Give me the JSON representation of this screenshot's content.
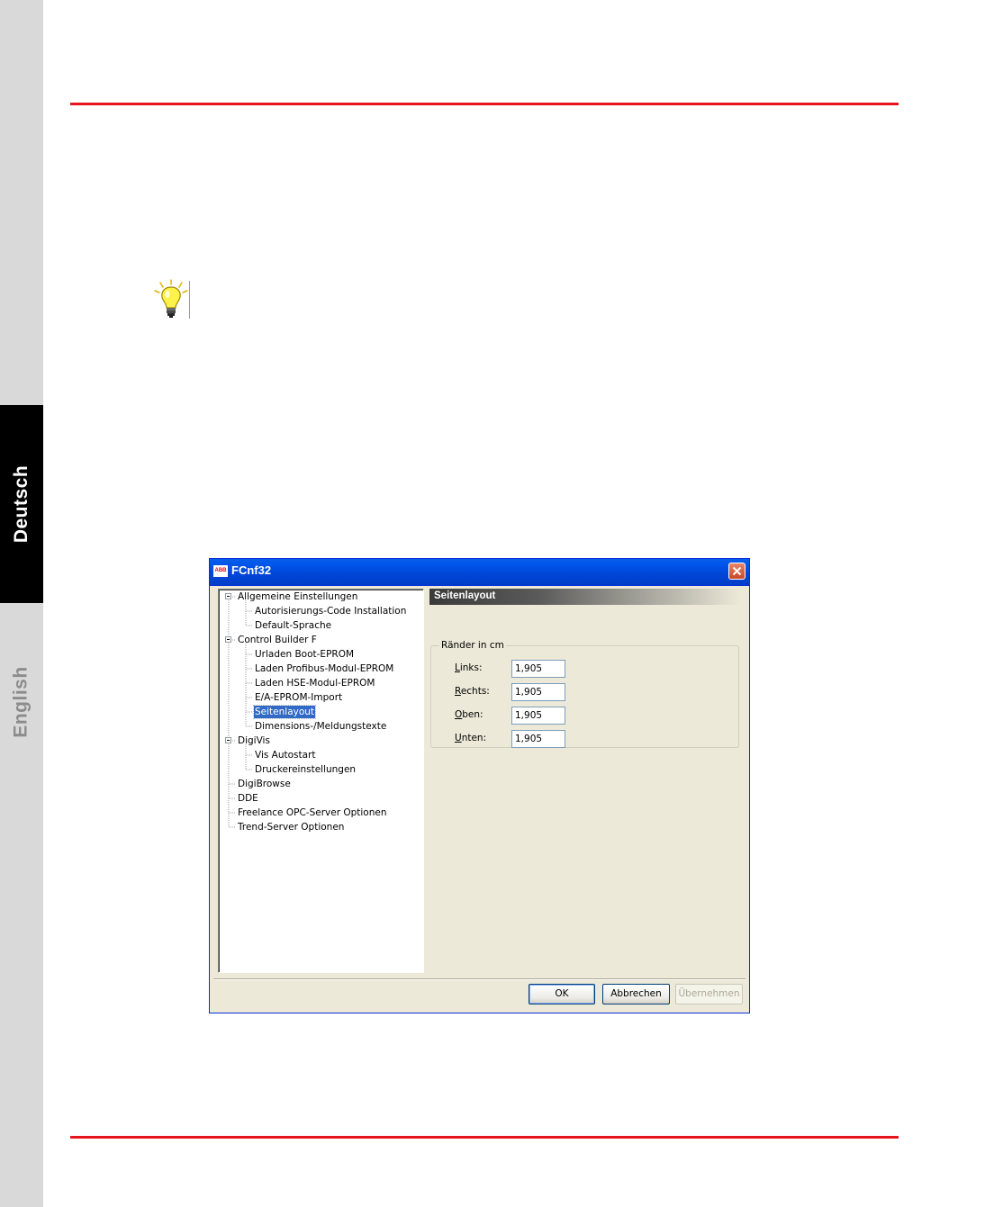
{
  "side_tabs": {
    "active": "Deutsch",
    "inactive": "English"
  },
  "colors": {
    "rule": "#e8141c",
    "title_bar": "#0054e3",
    "selection": "#316ac5"
  },
  "tip_icon": "lightbulb-icon",
  "dialog": {
    "logo_text": "ABB",
    "title": "FCnf32",
    "close_icon": "close-icon",
    "tree": [
      {
        "label": "Allgemeine Einstellungen",
        "level": 0,
        "expanded": true
      },
      {
        "label": "Autorisierungs-Code Installation",
        "level": 1
      },
      {
        "label": "Default-Sprache",
        "level": 1
      },
      {
        "label": "Control Builder F",
        "level": 0,
        "expanded": true
      },
      {
        "label": "Urladen Boot-EPROM",
        "level": 1
      },
      {
        "label": "Laden Profibus-Modul-EPROM",
        "level": 1
      },
      {
        "label": "Laden HSE-Modul-EPROM",
        "level": 1
      },
      {
        "label": "E/A-EPROM-Import",
        "level": 1
      },
      {
        "label": "Seitenlayout",
        "level": 1,
        "selected": true
      },
      {
        "label": "Dimensions-/Meldungstexte",
        "level": 1
      },
      {
        "label": "DigiVis",
        "level": 0,
        "expanded": true
      },
      {
        "label": "Vis Autostart",
        "level": 1
      },
      {
        "label": "Druckereinstellungen",
        "level": 1
      },
      {
        "label": "DigiBrowse",
        "level": 0
      },
      {
        "label": "DDE",
        "level": 0
      },
      {
        "label": "Freelance OPC-Server Optionen",
        "level": 0
      },
      {
        "label": "Trend-Server Optionen",
        "level": 0
      }
    ],
    "panel": {
      "header": "Seitenlayout",
      "group_title": "Ränder in cm",
      "fields": [
        {
          "label": "Links:",
          "mnemonic": "L",
          "value": "1,905"
        },
        {
          "label": "Rechts:",
          "mnemonic": "R",
          "value": "1,905"
        },
        {
          "label": "Oben:",
          "mnemonic": "O",
          "value": "1,905"
        },
        {
          "label": "Unten:",
          "mnemonic": "U",
          "value": "1,905"
        }
      ]
    },
    "buttons": {
      "ok": "OK",
      "cancel": "Abbrechen",
      "apply": "Übernehmen"
    }
  }
}
